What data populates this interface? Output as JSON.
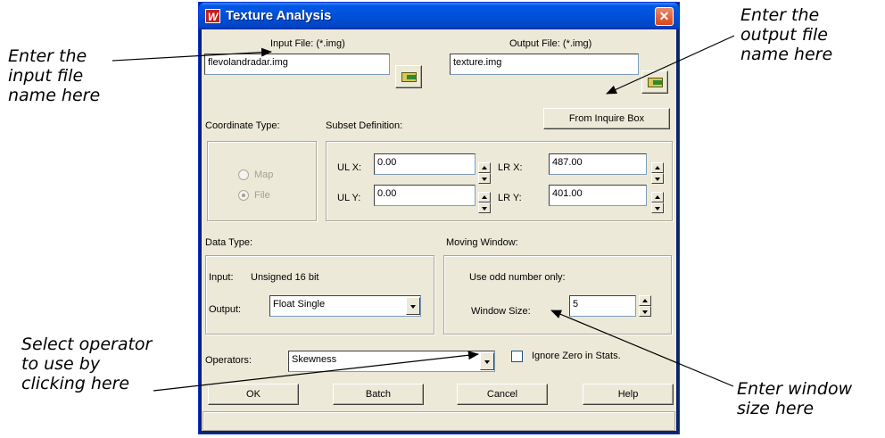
{
  "callouts": {
    "input_file": "Enter the\ninput file\nname here",
    "output_file": "Enter the\noutput file\nname here",
    "operator": "Select operator\nto use by\nclicking here",
    "window_size": "Enter window\nsize here"
  },
  "window": {
    "title": "Texture Analysis",
    "app_icon": "W",
    "close_glyph": "✕"
  },
  "input_file": {
    "label": "Input File: (*.img)",
    "value": "flevolandradar.img"
  },
  "output_file": {
    "label": "Output File: (*.img)",
    "value": "texture.img"
  },
  "coordinate_type": {
    "label": "Coordinate Type:",
    "options": [
      "Map",
      "File"
    ],
    "selected": "File"
  },
  "subset": {
    "label": "Subset Definition:",
    "from_inquire_label": "From Inquire Box",
    "ulx_label": "UL X:",
    "ulx": "0.00",
    "uly_label": "UL Y:",
    "uly": "0.00",
    "lrx_label": "LR X:",
    "lrx": "487.00",
    "lry_label": "LR Y:",
    "lry": "401.00"
  },
  "data_type": {
    "label": "Data Type:",
    "input_label": "Input:",
    "input_value": "Unsigned 16 bit",
    "output_label": "Output:",
    "output_value": "Float Single"
  },
  "moving_window": {
    "label": "Moving Window:",
    "hint": "Use odd number only:",
    "size_label": "Window Size:",
    "size_value": "5"
  },
  "operators": {
    "label": "Operators:",
    "value": "Skewness",
    "ignore_zero_label": "Ignore Zero in Stats."
  },
  "buttons": {
    "ok": "OK",
    "batch": "Batch",
    "cancel": "Cancel",
    "help": "Help"
  },
  "icons": {
    "folder": "folder-open-icon",
    "close": "close-icon",
    "spin": "spinner-arrows-icon",
    "dropdown": "chevron-down-icon"
  }
}
